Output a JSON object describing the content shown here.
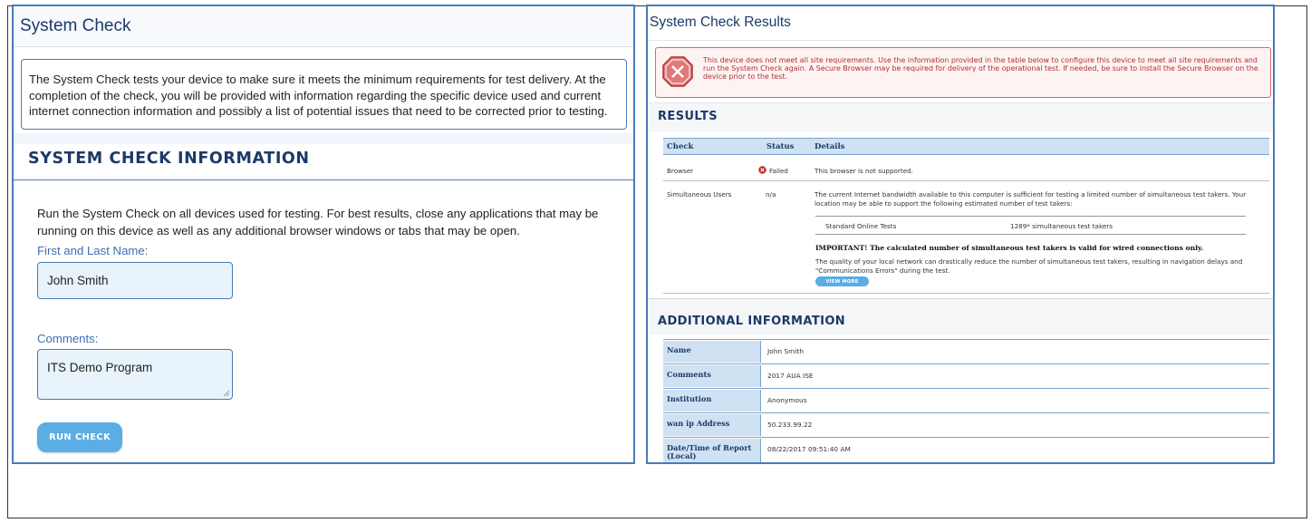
{
  "left": {
    "title": "System Check",
    "intro": "The System Check tests your device to make sure it meets the minimum requirements for test delivery. At the completion of the check, you will be provided with information regarding the specific device used and current internet connection information and possibly a list of potential issues that need to be corrected prior to testing.",
    "section_title": "SYSTEM CHECK INFORMATION",
    "run_text": "Run the System Check on all devices used for testing. For best results, close any applications that may be running on this device as well as any additional browser windows or tabs that may be open.",
    "name_label": "First and Last Name:",
    "name_value": "John Smith",
    "comments_label": "Comments:",
    "comments_value": "ITS Demo Program",
    "run_button": "RUN CHECK"
  },
  "right": {
    "title": "System Check Results",
    "alert": "This device does not meet all site requirements. Use the information provided in the table below to configure this device to meet all site requirements and run the System Check again. A Secure Browser may be required for delivery of the operational test. If needed, be sure to install the Secure Browser on the device prior to the test.",
    "results_title": "RESULTS",
    "columns": [
      "Check",
      "Status",
      "Details"
    ],
    "rows": [
      {
        "check": "Browser",
        "status": "Failed",
        "details": "This browser is not supported."
      },
      {
        "check": "Simultaneous Users",
        "status": "n/a",
        "details": "The current Internet bandwidth available to this computer is sufficient for testing a limited number of simultaneous test takers. Your location may be able to support the following estimated number of test takers:"
      }
    ],
    "sub_row": {
      "label": "Standard Online Tests",
      "value": "1289* simultaneous test takers"
    },
    "important": "IMPORTANT! The calculated number of simultaneous test takers is valid for wired connections only.",
    "quality_note": "The quality of your local network can drastically reduce the number of simultaneous test takers, resulting in navigation delays and \"Communications Errors\" during the test.",
    "view_more": "VIEW MORE",
    "addl_title": "ADDITIONAL INFORMATION",
    "info": [
      {
        "key": "Name",
        "value": "John Smith"
      },
      {
        "key": "Comments",
        "value": "2017 AUA ISE"
      },
      {
        "key": "Institution",
        "value": "Anonymous"
      },
      {
        "key": "wan ip Address",
        "value": "50.233.99.22"
      },
      {
        "key": "Date/Time of Report (Local)",
        "value": "08/22/2017 09:51:40 AM"
      }
    ]
  },
  "colors": {
    "heading_navy": "#1c3968",
    "panel_border": "#4a7ab8",
    "button_blue": "#5aaee4",
    "alert_red": "#b03030",
    "table_header_bg": "#cfe2f3",
    "input_bg": "#e8f3fb"
  },
  "icons": {
    "alert": "stop-x-icon",
    "failed": "error-circle-icon"
  }
}
